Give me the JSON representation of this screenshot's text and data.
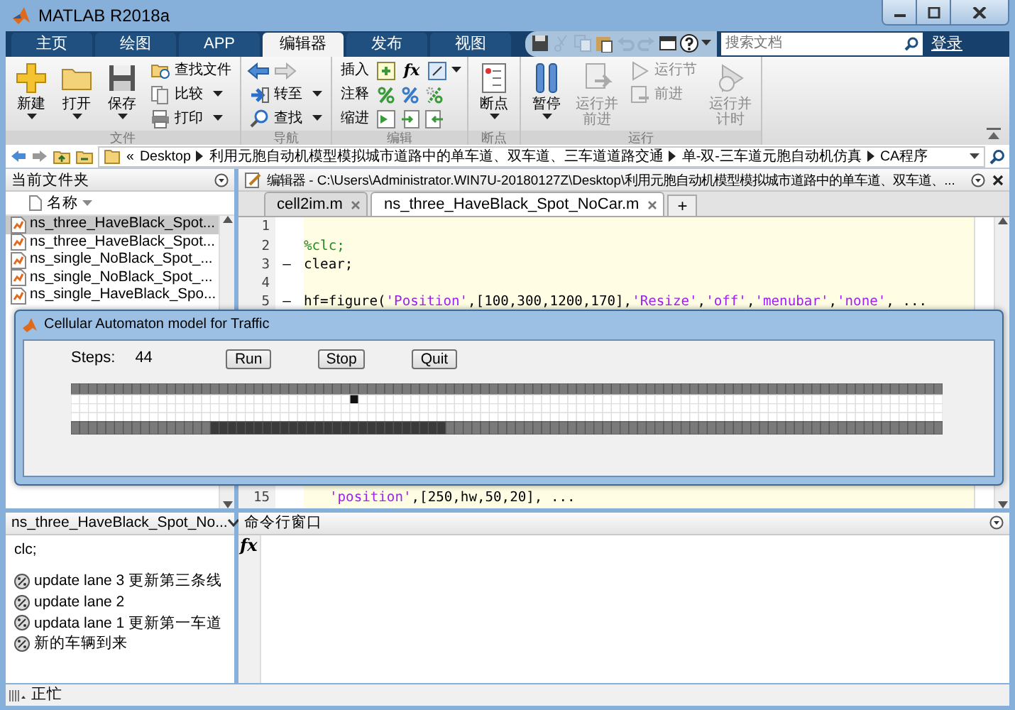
{
  "window": {
    "title": "MATLAB R2018a"
  },
  "ribbon_tabs": [
    {
      "label": "主页",
      "selected": false
    },
    {
      "label": "绘图",
      "selected": false
    },
    {
      "label": "APP",
      "selected": false
    },
    {
      "label": "编辑器",
      "selected": true
    },
    {
      "label": "发布",
      "selected": false
    },
    {
      "label": "视图",
      "selected": false
    }
  ],
  "quick_access": [
    {
      "kind": "save",
      "disabled": false
    },
    {
      "kind": "cut",
      "disabled": true
    },
    {
      "kind": "copy",
      "disabled": true
    },
    {
      "kind": "paste",
      "disabled": false
    },
    {
      "kind": "undo",
      "disabled": true
    },
    {
      "kind": "redo",
      "disabled": true
    },
    {
      "kind": "windows",
      "disabled": false
    },
    {
      "kind": "help",
      "disabled": false
    },
    {
      "kind": "menu",
      "disabled": false
    }
  ],
  "search": {
    "placeholder": "搜索文档"
  },
  "login": "登录",
  "ribbon_groups": [
    {
      "label": "文件",
      "items": [
        {
          "kind": "large",
          "label": "新建",
          "dropdown": true,
          "disabled": false
        },
        {
          "kind": "large",
          "label": "打开",
          "dropdown": true,
          "disabled": false
        },
        {
          "kind": "large",
          "label": "保存",
          "dropdown": true,
          "disabled": false
        },
        {
          "kind": "stack",
          "rows": [
            {
              "label": "查找文件",
              "dropdown": false,
              "disabled": false
            },
            {
              "label": "比较",
              "dropdown": true,
              "disabled": false
            },
            {
              "label": "打印",
              "dropdown": true,
              "disabled": false
            }
          ]
        }
      ]
    },
    {
      "label": "导航",
      "items": [
        {
          "kind": "stack",
          "rows": [
            {
              "kind": "arrows"
            },
            {
              "label": "转至",
              "dropdown": true,
              "disabled": false
            },
            {
              "label": "查找",
              "dropdown": true,
              "disabled": false
            }
          ]
        }
      ]
    },
    {
      "label": "编辑",
      "items": [
        {
          "kind": "tools",
          "rows": [
            {
              "label": "插入",
              "dropdown": true,
              "tools": [
                {
                  "kind": "icon"
                },
                {
                  "kind": "text",
                  "text": "fx"
                },
                {
                  "kind": "icon"
                }
              ]
            },
            {
              "label": "注释",
              "dropdown": false,
              "tools": [
                {
                  "kind": "icon"
                },
                {
                  "kind": "icon"
                },
                {
                  "kind": "icon"
                }
              ]
            },
            {
              "label": "缩进",
              "dropdown": false,
              "tools": [
                {
                  "kind": "icon"
                },
                {
                  "kind": "icon"
                },
                {
                  "kind": "icon"
                }
              ]
            }
          ]
        }
      ]
    },
    {
      "label": "断点",
      "items": [
        {
          "kind": "large",
          "label": "断点",
          "dropdown": true,
          "disabled": false
        }
      ]
    },
    {
      "label": "运行",
      "items": [
        {
          "kind": "large",
          "label": "暂停",
          "dropdown": true,
          "disabled": false
        },
        {
          "kind": "large",
          "label": "运行并前进",
          "dropdown": false,
          "disabled": true
        },
        {
          "kind": "stack",
          "rows": [
            {
              "label": "运行节",
              "dropdown": false,
              "disabled": true
            },
            {
              "label": "前进",
              "dropdown": false,
              "disabled": true
            }
          ]
        },
        {
          "kind": "large",
          "label": "运行并计时",
          "dropdown": false,
          "disabled": true
        }
      ]
    }
  ],
  "address_bar": {
    "prefix": "«",
    "path": [
      "Desktop",
      "利用元胞自动机模型模拟城市道路中的单车道、双车道、三车道道路交通",
      "单-双-三车道元胞自动机仿真",
      "CA程序"
    ]
  },
  "current_folder": {
    "title": "当前文件夹",
    "column": "名称",
    "files": [
      {
        "name": "ns_three_HaveBlack_Spot...",
        "selected": true
      },
      {
        "name": "ns_three_HaveBlack_Spot...",
        "selected": false
      },
      {
        "name": "ns_single_NoBlack_Spot_...",
        "selected": false
      },
      {
        "name": "ns_single_NoBlack_Spot_...",
        "selected": false
      },
      {
        "name": "ns_single_HaveBlack_Spo...",
        "selected": false
      }
    ]
  },
  "details": {
    "title": "ns_three_HaveBlack_Spot_No...",
    "lines": [
      {
        "kind": "code",
        "text": "clc;"
      },
      {
        "kind": "cell",
        "text": "update lane 3 更新第三条线"
      },
      {
        "kind": "cell",
        "text": "update lane 2"
      },
      {
        "kind": "cell",
        "text": "updata lane 1 更新第一车道"
      },
      {
        "kind": "cell",
        "text": "新的车辆到来"
      }
    ]
  },
  "editor": {
    "title": "编辑器 - C:\\Users\\Administrator.WIN7U-20180127Z\\Desktop\\利用元胞自动机模型模拟城市道路中的单车道、双车道、...",
    "tabs": [
      {
        "label": "cell2im.m",
        "selected": false
      },
      {
        "label": "ns_three_HaveBlack_Spot_NoCar.m",
        "selected": true
      }
    ],
    "add_tab": "+",
    "lines": [
      {
        "number": "1"
      },
      {
        "number": "2",
        "code": [
          {
            "kind": "comment",
            "text": "%clc;"
          }
        ]
      },
      {
        "number": "3",
        "marker": "—",
        "code": [
          {
            "kind": "plain",
            "text": "clear;"
          }
        ]
      },
      {
        "number": "4"
      },
      {
        "number": "5",
        "marker": "—",
        "code": [
          {
            "kind": "plain",
            "text": "hf=figure("
          },
          {
            "kind": "string",
            "text": "'Position'"
          },
          {
            "kind": "plain",
            "text": ",[100,300,1200,170],"
          },
          {
            "kind": "string",
            "text": "'Resize'"
          },
          {
            "kind": "plain",
            "text": ","
          },
          {
            "kind": "string",
            "text": "'off'"
          },
          {
            "kind": "plain",
            "text": ","
          },
          {
            "kind": "string",
            "text": "'menubar'"
          },
          {
            "kind": "plain",
            "text": ","
          },
          {
            "kind": "string",
            "text": "'none'"
          },
          {
            "kind": "plain",
            "text": ", ..."
          }
        ]
      },
      {
        "number": "15",
        "indented": true,
        "code": [
          {
            "kind": "string",
            "text": "'position'"
          },
          {
            "kind": "plain",
            "text": ",[250,hw,50,20], ..."
          }
        ]
      }
    ]
  },
  "command_window": {
    "title": "命令行窗口",
    "prompt": "fx"
  },
  "status_bar": {
    "text": "正忙"
  },
  "figure": {
    "title": "Cellular Automaton model for Traffic",
    "steps_label": "Steps:",
    "steps_value": "44",
    "buttons": [
      "Run",
      "Stop",
      "Quit"
    ]
  }
}
